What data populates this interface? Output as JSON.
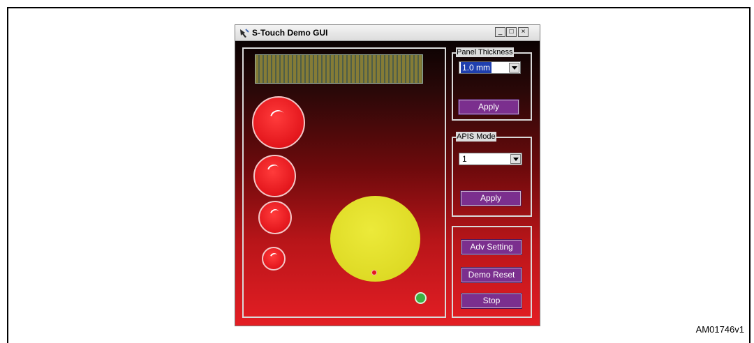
{
  "window": {
    "title": "S-Touch Demo GUI",
    "controls": [
      "_",
      "□",
      "×"
    ]
  },
  "panel_thickness": {
    "label": "Panel Thickness",
    "selected": "1.0 mm",
    "apply_label": "Apply"
  },
  "apis_mode": {
    "label": "APIS Mode",
    "selected": "1",
    "apply_label": "Apply"
  },
  "actions": {
    "adv_setting": "Adv Setting",
    "demo_reset": "Demo Reset",
    "stop": "Stop"
  },
  "figure_id": "AM01746v1",
  "colors": {
    "button_purple": "#7b2f8e",
    "touch_red": "#e3161c",
    "wheel_yellow": "#e3e027",
    "indicator_green": "#3cb043"
  }
}
